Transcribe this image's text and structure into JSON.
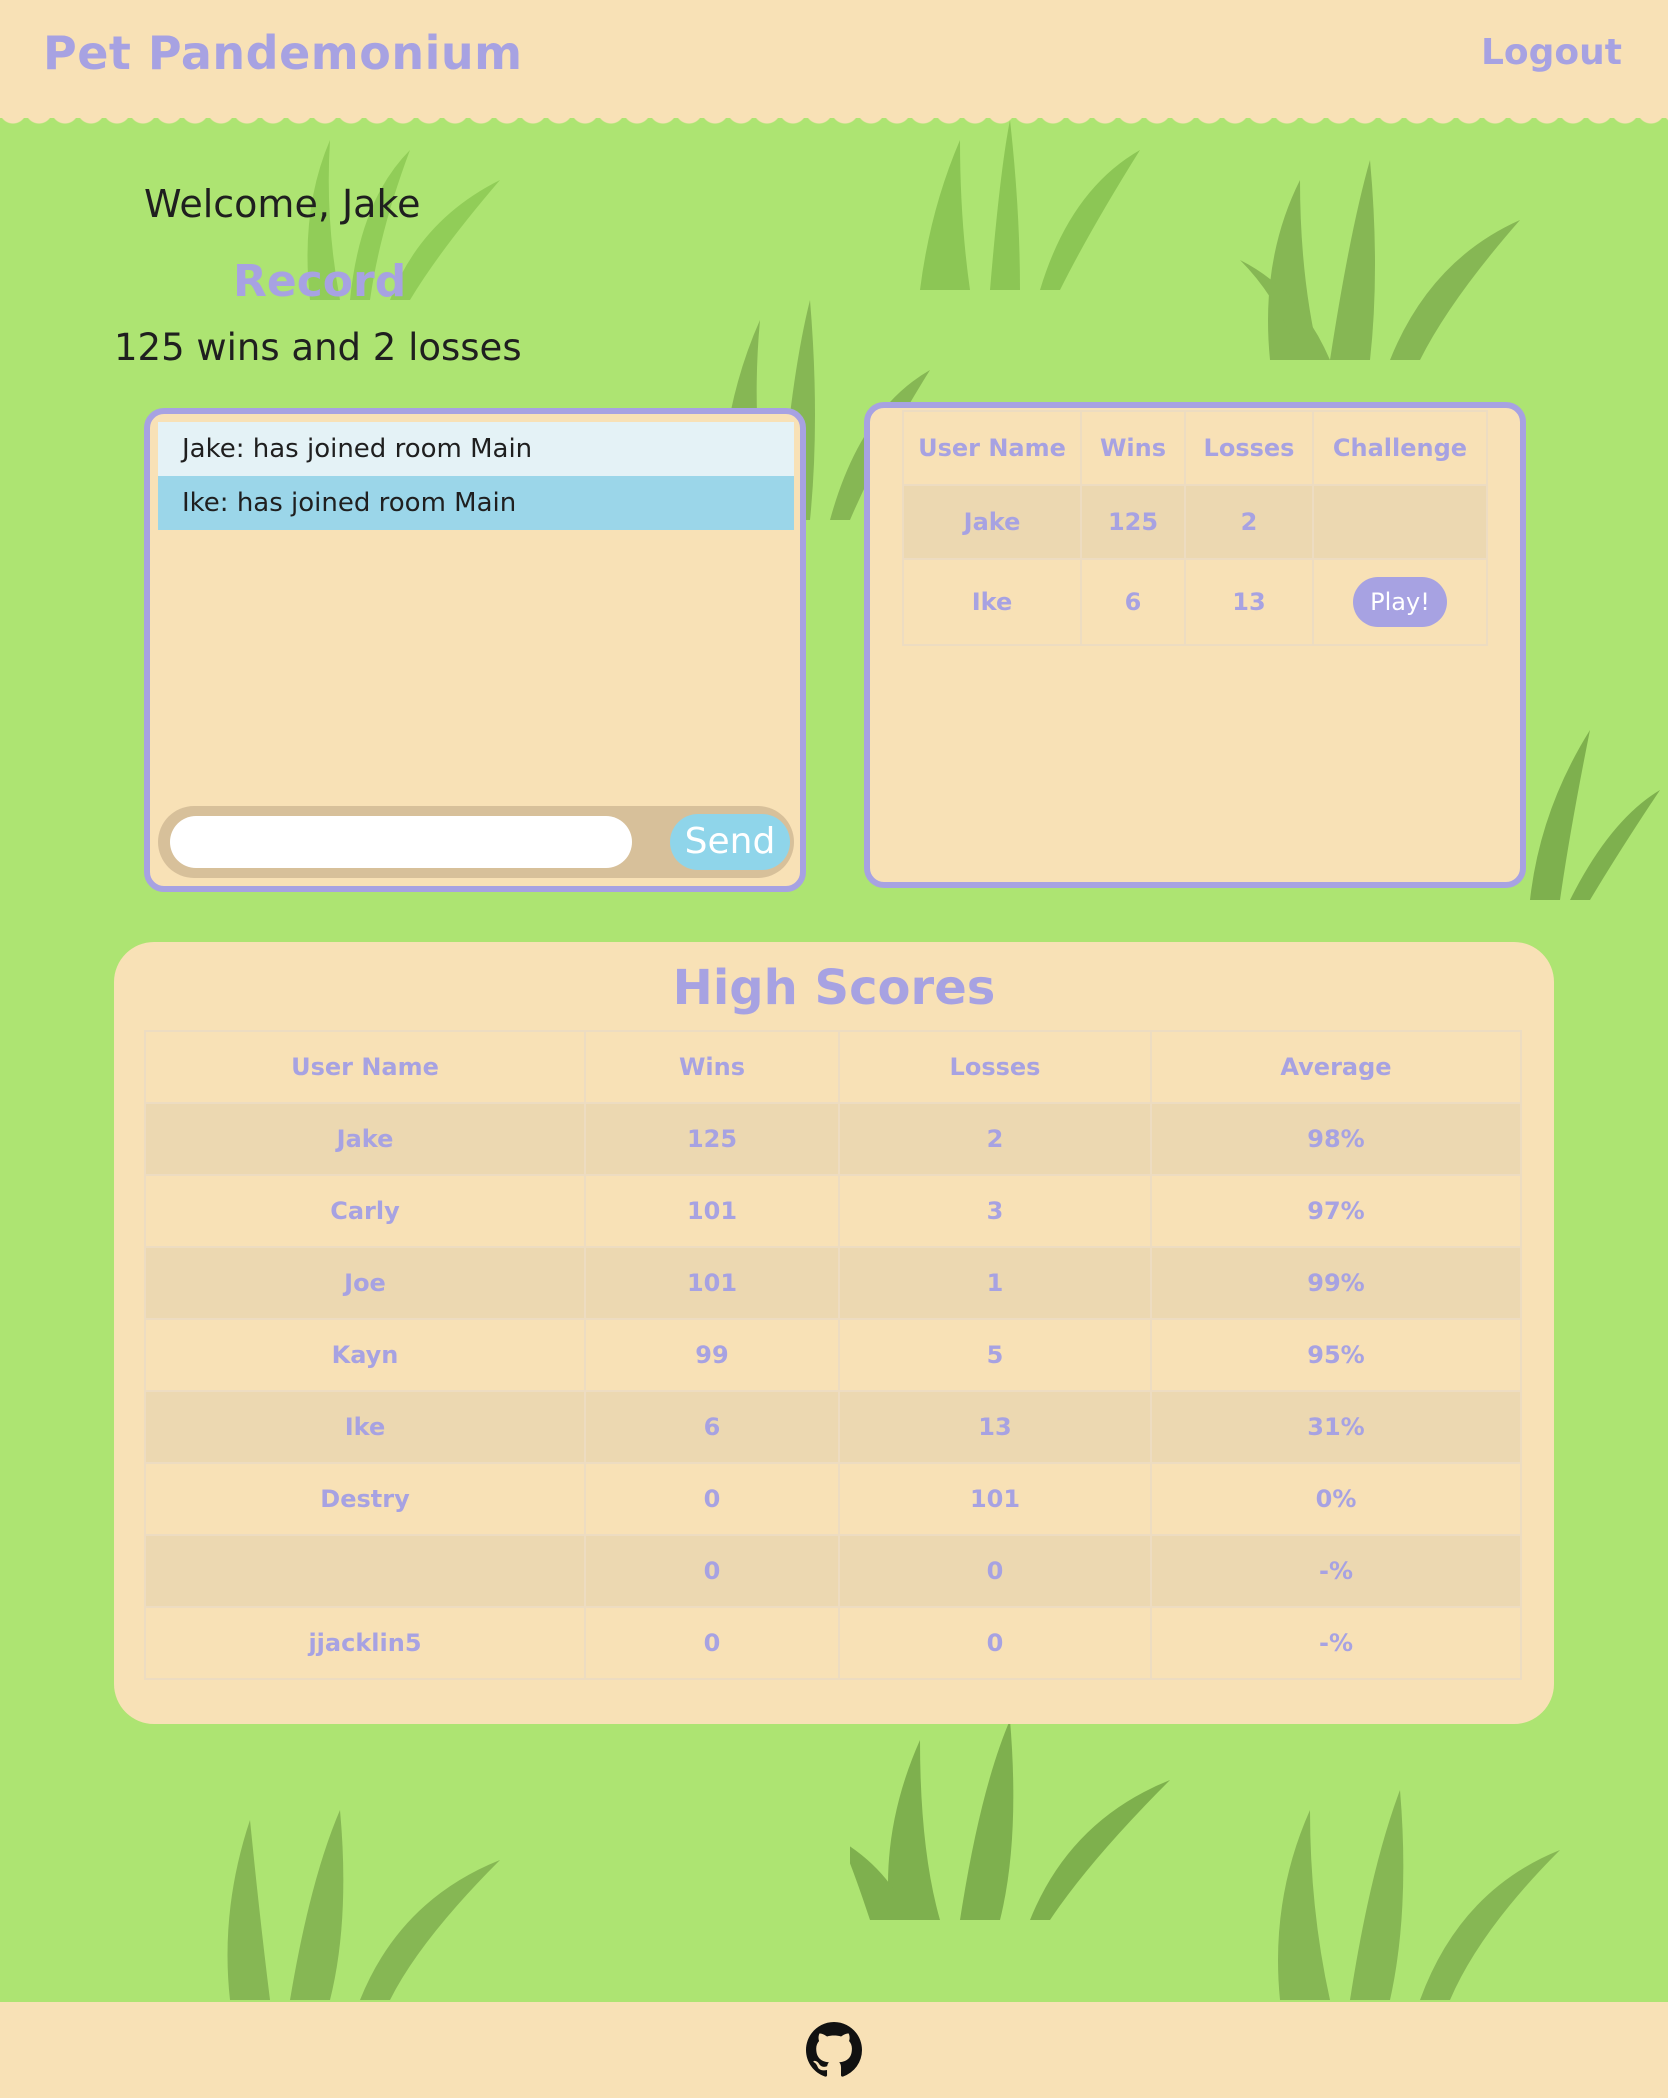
{
  "header": {
    "brand": "Pet Pandemonium",
    "logout_label": "Logout"
  },
  "welcome": "Welcome, Jake",
  "record": {
    "title": "Record",
    "text": "125 wins and 2 losses"
  },
  "chat": {
    "messages": [
      "Jake: has joined room Main",
      "Ike: has joined room Main"
    ],
    "input_value": "",
    "send_label": "Send"
  },
  "users_table": {
    "headers": [
      "User Name",
      "Wins",
      "Losses",
      "Challenge"
    ],
    "rows": [
      {
        "name": "Jake",
        "wins": "125",
        "losses": "2",
        "challenge": ""
      },
      {
        "name": "Ike",
        "wins": "6",
        "losses": "13",
        "challenge": "Play!"
      }
    ]
  },
  "high_scores": {
    "title": "High Scores",
    "headers": [
      "User Name",
      "Wins",
      "Losses",
      "Average"
    ],
    "rows": [
      {
        "name": "Jake",
        "wins": "125",
        "losses": "2",
        "average": "98%"
      },
      {
        "name": "Carly",
        "wins": "101",
        "losses": "3",
        "average": "97%"
      },
      {
        "name": "Joe",
        "wins": "101",
        "losses": "1",
        "average": "99%"
      },
      {
        "name": "Kayn",
        "wins": "99",
        "losses": "5",
        "average": "95%"
      },
      {
        "name": "Ike",
        "wins": "6",
        "losses": "13",
        "average": "31%"
      },
      {
        "name": "Destry",
        "wins": "0",
        "losses": "101",
        "average": "0%"
      },
      {
        "name": "",
        "wins": "0",
        "losses": "0",
        "average": "-%"
      },
      {
        "name": "jjacklin5",
        "wins": "0",
        "losses": "0",
        "average": "-%"
      }
    ]
  },
  "footer": {
    "icon": "github-icon"
  },
  "colors": {
    "accent": "#a7a2e2",
    "background": "#ade472",
    "panel": "#f8e1b6",
    "send_button": "#8fd5ea"
  }
}
